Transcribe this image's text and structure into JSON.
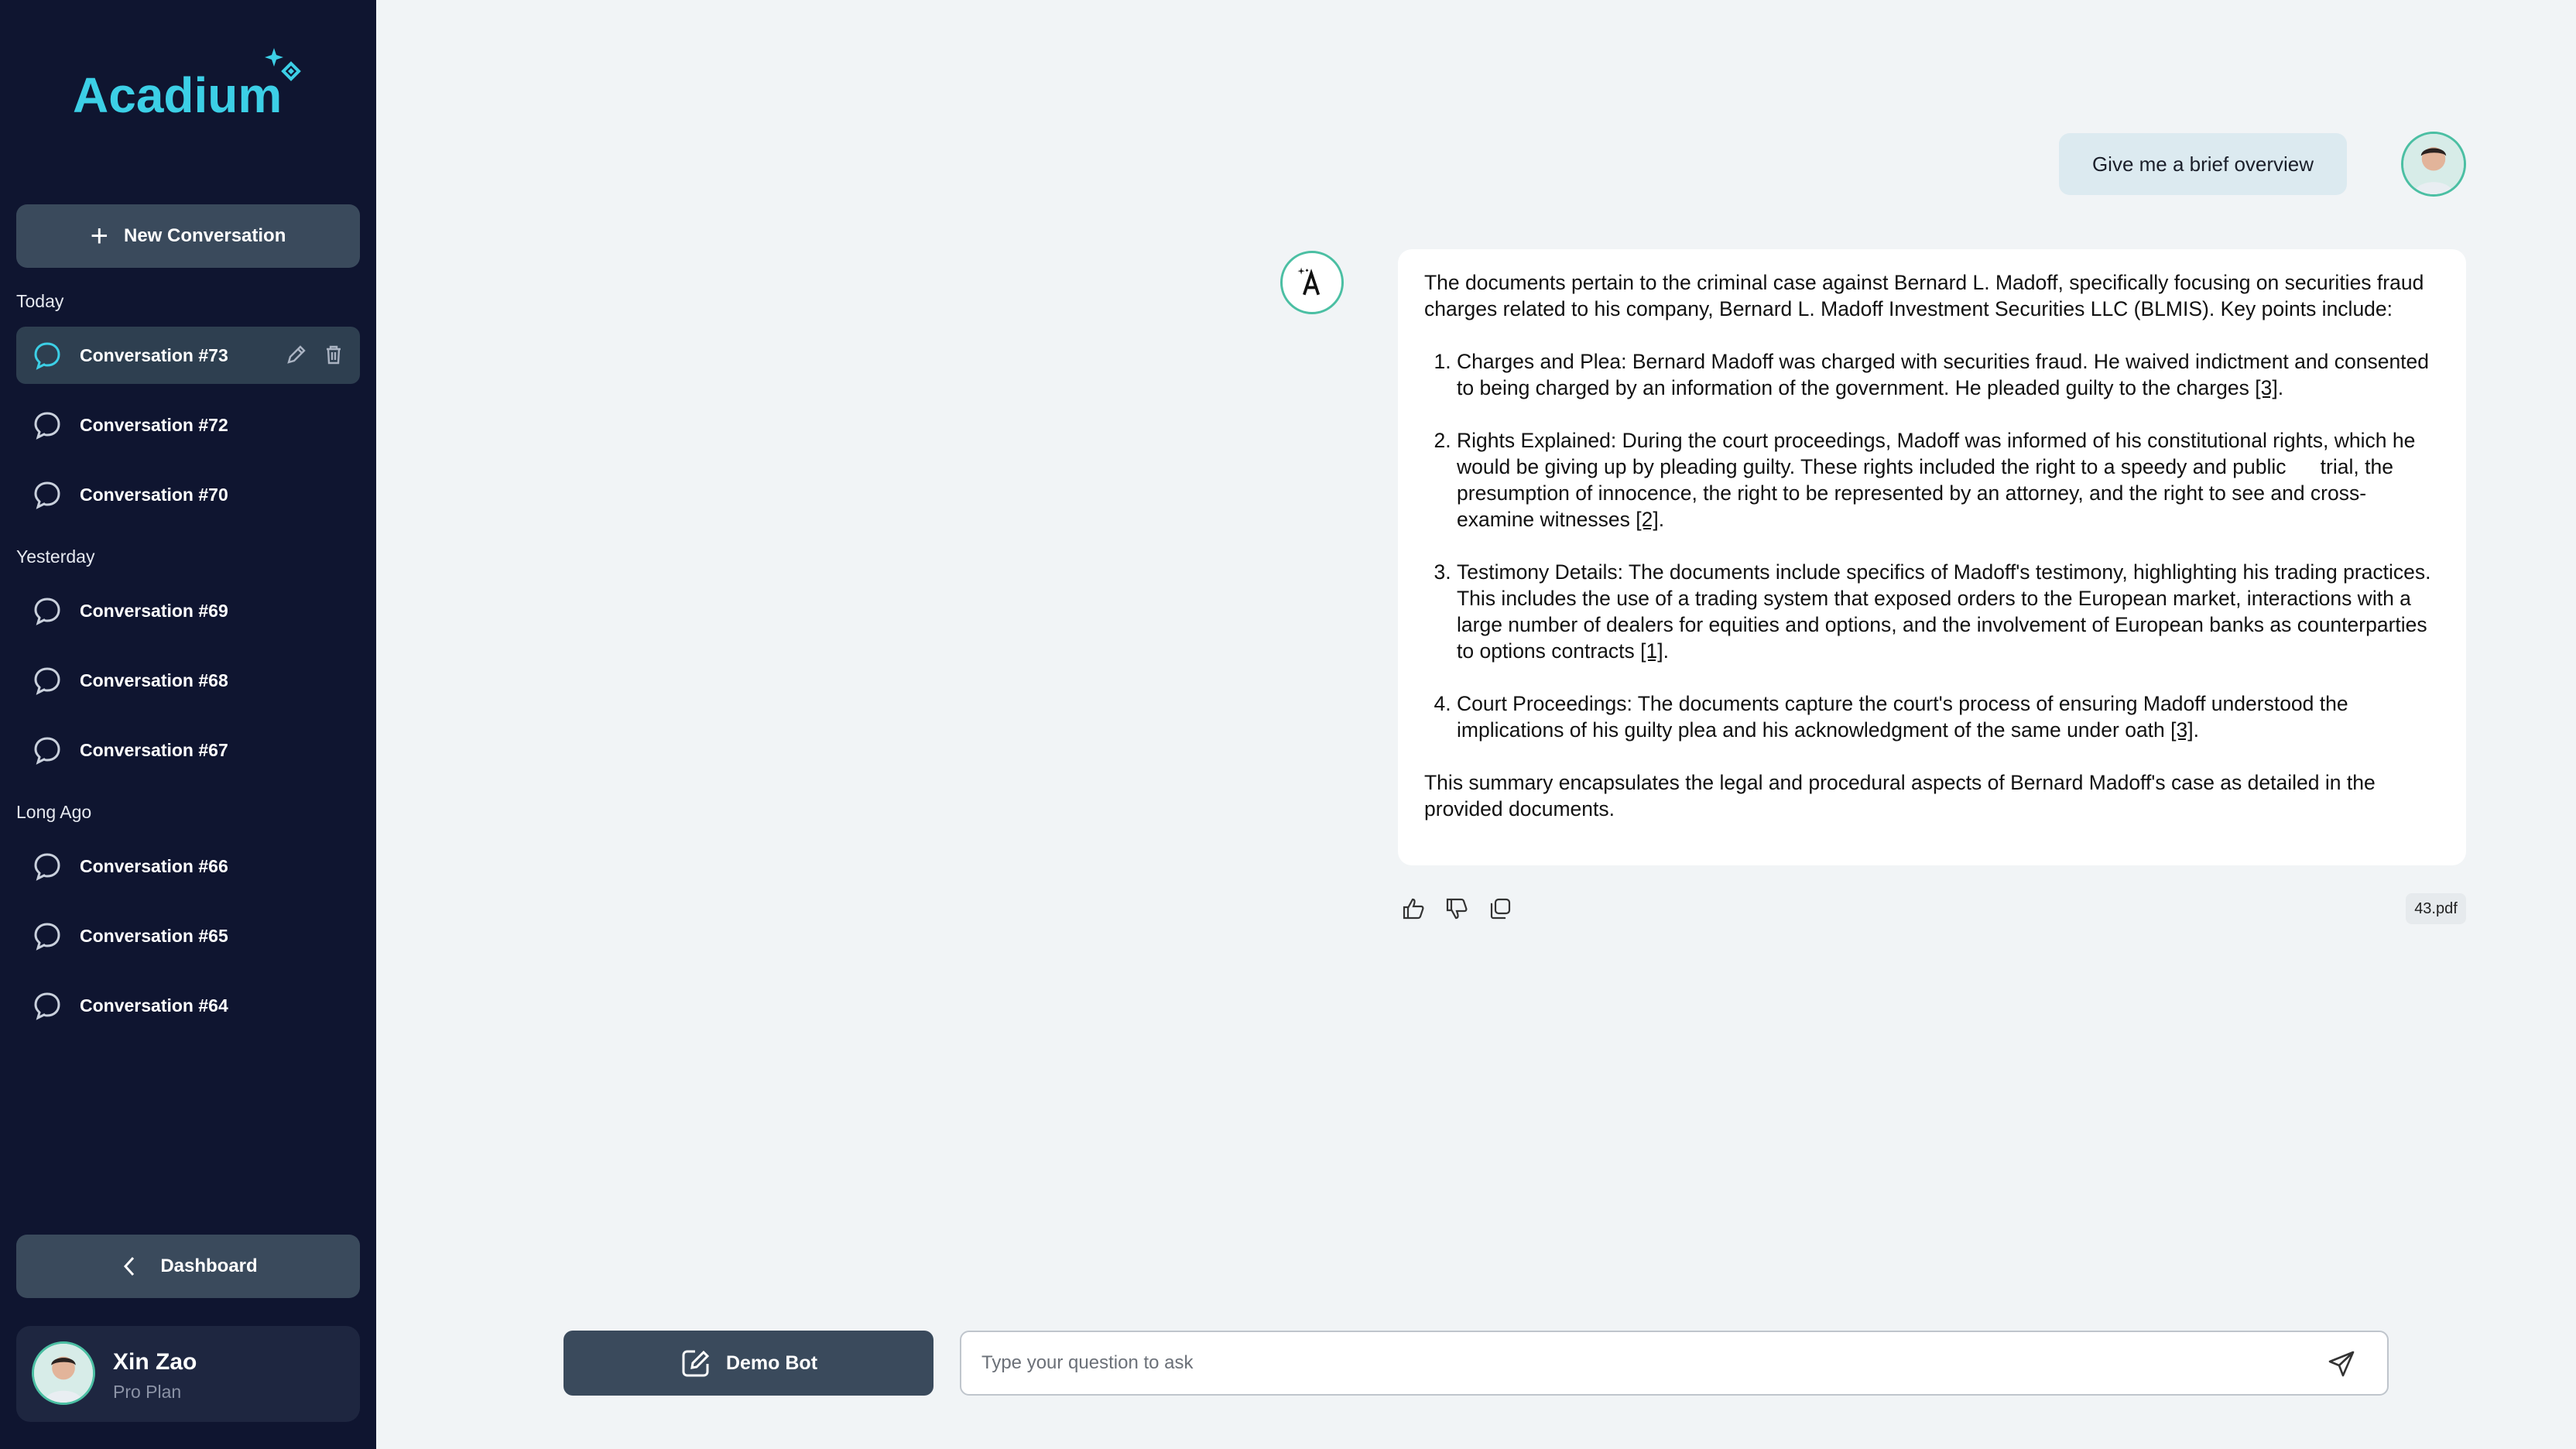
{
  "app": {
    "logo_text": "Acadium"
  },
  "sidebar": {
    "new_conversation_label": "New Conversation",
    "groups": [
      {
        "label": "Today",
        "items": [
          "Conversation #73",
          "Conversation #72",
          "Conversation #70"
        ]
      },
      {
        "label": "Yesterday",
        "items": [
          "Conversation #69",
          "Conversation #68",
          "Conversation #67"
        ]
      },
      {
        "label": "Long Ago",
        "items": [
          "Conversation #66",
          "Conversation #65",
          "Conversation #64"
        ]
      }
    ],
    "active_item": "Conversation #73",
    "dashboard_label": "Dashboard",
    "user": {
      "name": "Xin Zao",
      "plan": "Pro Plan"
    }
  },
  "chat": {
    "user_message": "Give me a brief overview",
    "answer": {
      "intro": "The documents pertain to the criminal case against Bernard L. Madoff, specifically focusing on securities fraud charges related to his company, Bernard L. Madoff Investment Securities LLC (BLMIS). Key points include:",
      "points": [
        {
          "text": "Charges and Plea: Bernard Madoff was charged with securities fraud. He waived indictment and consented to being charged by an information of the government. He pleaded guilty to the charges ",
          "cite": "[3]"
        },
        {
          "text": "Rights Explained: During the court proceedings, Madoff was informed of his constitutional rights, which he would be giving up by pleading guilty. These rights included the right to a speedy and public      trial, the presumption of innocence, the right to be represented by an attorney, and the right to see and cross-examine witnesses ",
          "cite": "[2]"
        },
        {
          "text": "Testimony Details: The documents include specifics of Madoff's testimony, highlighting his trading practices. This includes the use of a trading system that exposed orders to the European market, interactions with a large number of dealers for equities and options, and the involvement of European banks as counterparties to options contracts ",
          "cite": "[1]"
        },
        {
          "text": "Court Proceedings: The documents capture the court's process of ensuring Madoff understood the implications of his guilty plea and his acknowledgment of the same under oath ",
          "cite": "[3]"
        }
      ],
      "summary": "This summary encapsulates the legal and procedural aspects of Bernard Madoff's case as detailed in the provided documents."
    },
    "source_file": "43.pdf"
  },
  "composer": {
    "bot_button_label": "Demo Bot",
    "placeholder": "Type your question to ask"
  },
  "colors": {
    "accent": "#3ccfe6",
    "sidebar_bg": "#0f1530",
    "button_bg": "#3a4a5c",
    "bot_ring": "#4bbfa3"
  }
}
